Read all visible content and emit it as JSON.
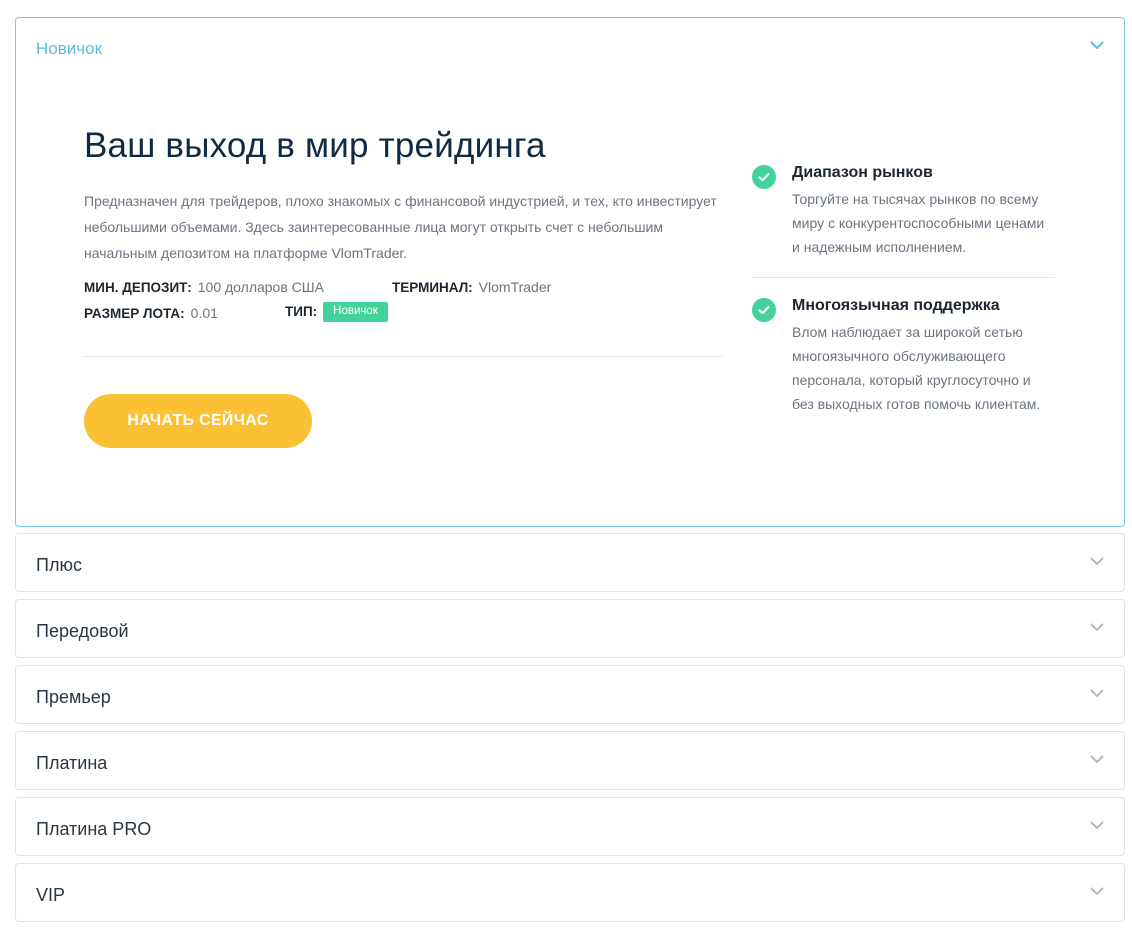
{
  "accordion": {
    "active": {
      "title": "Новичок",
      "heading": "Ваш выход в мир трейдинга",
      "description": "Предназначен для трейдеров, плохо знакомых с финансовой индустрией, и тех, кто инвестирует небольшими объемами. Здесь заинтересованные лица могут открыть счет с небольшим начальным депозитом на платформе VlomTrader.",
      "specs": {
        "min_deposit_label": "МИН. ДЕПОЗИТ:",
        "min_deposit_value": "100 долларов США",
        "terminal_label": "ТЕРМИНАЛ:",
        "terminal_value": "VlomTrader",
        "lot_size_label": "РАЗМЕР ЛОТА:",
        "lot_size_value": "0.01",
        "type_label": "ТИП:",
        "type_value": "Новичок"
      },
      "cta_label": "НАЧАТЬ СЕЙЧАС",
      "features": [
        {
          "title": "Диапазон рынков",
          "text": "Торгуйте на тысячах рынков по всему миру с конкурентоспособными ценами и надежным исполнением."
        },
        {
          "title": "Многоязычная поддержка",
          "text": "Влом наблюдает за широкой сетью многоязычного обслуживающего персонала, который круглосуточно и без выходных готов помочь клиентам."
        }
      ]
    },
    "collapsed": [
      {
        "title": "Плюс"
      },
      {
        "title": "Передовой"
      },
      {
        "title": "Премьер"
      },
      {
        "title": "Платина"
      },
      {
        "title": "Платина PRO"
      },
      {
        "title": "VIP"
      }
    ]
  },
  "icons": {
    "chevron": "chevron-down-icon",
    "check": "check-circle-icon"
  },
  "colors": {
    "accent_blue": "#5bbbe4",
    "cta_yellow": "#fbc034",
    "check_green": "#43d39a",
    "heading_dark": "#0f2a44"
  }
}
